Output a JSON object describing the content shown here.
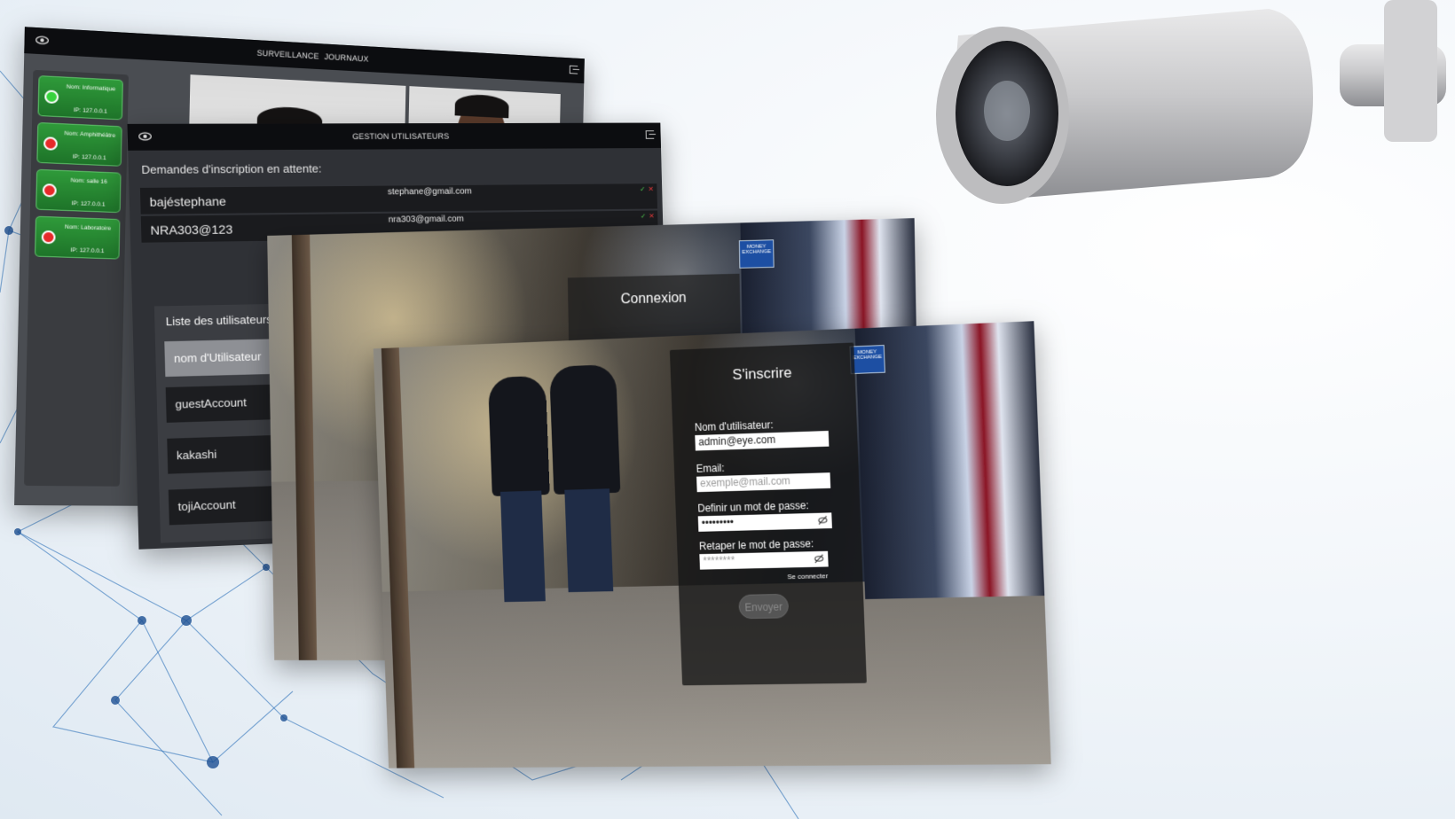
{
  "surveillance_window": {
    "nav": [
      "SURVEILLANCE",
      "JOURNAUX"
    ],
    "cameras": [
      {
        "name": "Nom: Informatique",
        "ip": "IP: 127.0.0.1",
        "status": "online"
      },
      {
        "name": "Nom: Amphithéâtre",
        "ip": "IP: 127.0.0.1",
        "status": "offline"
      },
      {
        "name": "Nom: salle 16",
        "ip": "IP: 127.0.0.1",
        "status": "offline"
      },
      {
        "name": "Nom: Laboratoire",
        "ip": "IP: 127.0.0.1",
        "status": "offline"
      }
    ]
  },
  "users_window": {
    "title": "GESTION UTILISATEURS",
    "pending_title": "Demandes d'inscription en attente:",
    "pending": [
      {
        "username": "bajéstephane",
        "email": "stephane@gmail.com",
        "accept": "✓",
        "reject": "✕"
      },
      {
        "username": "NRA303@123",
        "email": "nra303@gmail.com",
        "accept": "✓",
        "reject": "✕"
      }
    ],
    "list_title": "Liste des utilisateurs",
    "list_header": "nom d'Utilisateur",
    "users": [
      "guestAccount",
      "kakashi",
      "tojiAccount"
    ]
  },
  "login_window": {
    "title": "Connexion",
    "sign": "MONEY EXCHANGE"
  },
  "signup_window": {
    "title": "S'inscrire",
    "username_label": "Nom d'utilisateur:",
    "username_value": "admin@eye.com",
    "email_label": "Email:",
    "email_placeholder": "exemple@mail.com",
    "password_label": "Definir un mot de passe:",
    "password_value": "•••••••••",
    "repeat_label": "Retaper le mot de passe:",
    "repeat_placeholder": "********",
    "login_link": "Se connecter",
    "submit": "Envoyer",
    "sign": "MONEY EXCHANGE"
  },
  "colors": {
    "online": "#37d33d",
    "offline": "#e62a2a",
    "card_green": "#2f9a3a",
    "topbar": "#0c0d10"
  }
}
